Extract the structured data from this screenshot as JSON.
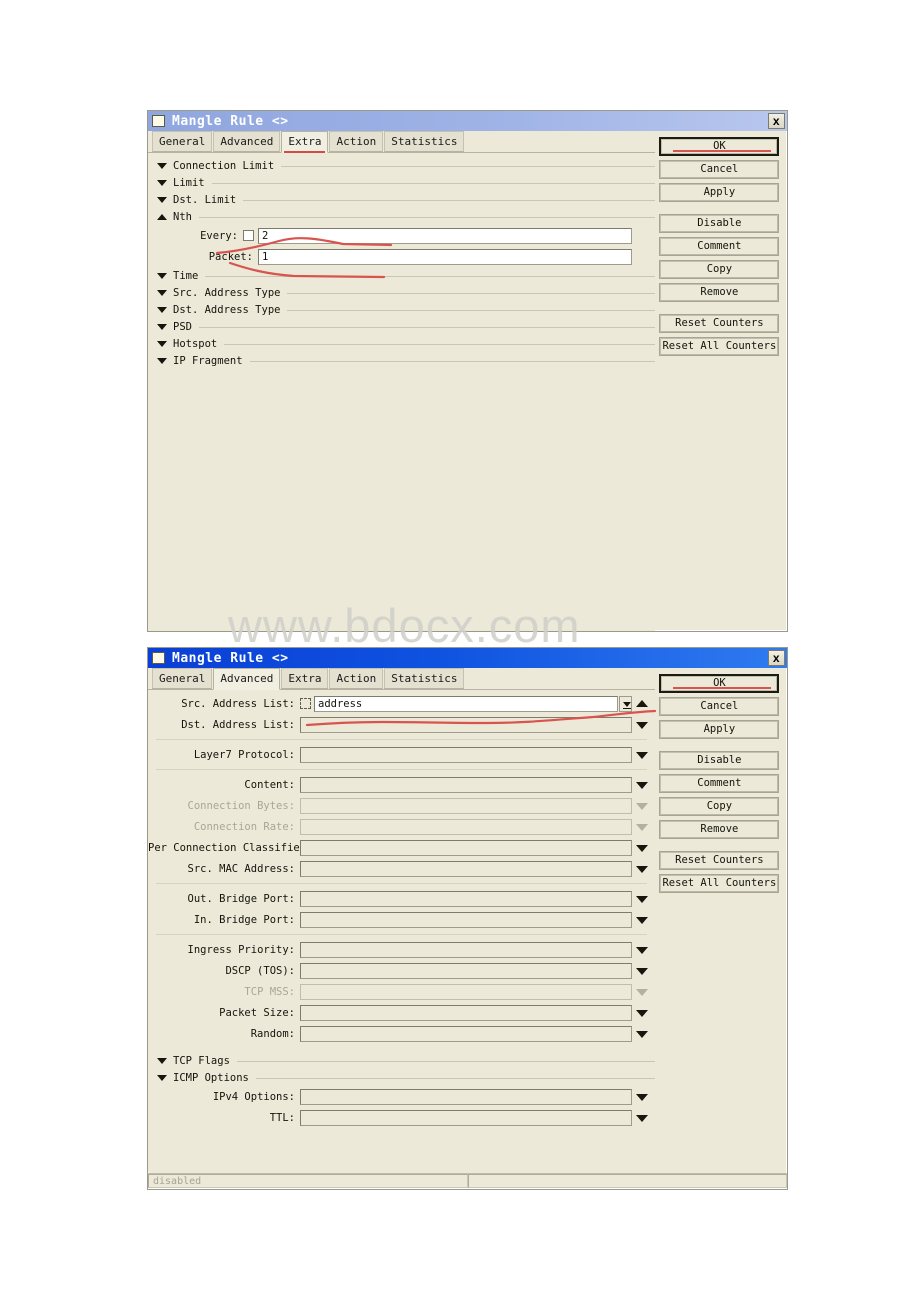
{
  "page": {
    "watermark": "www.bdocx.com",
    "background_color": "#ffffff"
  },
  "colors": {
    "dialog_face": "#ece9d8",
    "titlebar_active": "#0f52e0",
    "titlebar_inactive": "#9fb3e6",
    "annotation_red": "#d8544f",
    "field_white": "#ffffff",
    "disabled_text": "#a8a698"
  },
  "buttons_common": [
    {
      "label": "OK",
      "focused": true,
      "annotated": true
    },
    {
      "label": "Cancel",
      "focused": false,
      "annotated": false
    },
    {
      "label": "Apply",
      "focused": false,
      "annotated": false
    },
    {
      "label": "Disable",
      "focused": false,
      "annotated": false
    },
    {
      "label": "Comment",
      "focused": false,
      "annotated": false
    },
    {
      "label": "Copy",
      "focused": false,
      "annotated": false
    },
    {
      "label": "Remove",
      "focused": false,
      "annotated": false
    },
    {
      "label": "Reset Counters",
      "focused": false,
      "annotated": false
    },
    {
      "label": "Reset All Counters",
      "focused": false,
      "annotated": false
    }
  ],
  "dialog1": {
    "title": "Mangle Rule <>",
    "titlebar_state": "inactive",
    "close_icon": "close-icon",
    "close_label": "x",
    "tabs": [
      {
        "label": "General",
        "active": false
      },
      {
        "label": "Advanced",
        "active": false
      },
      {
        "label": "Extra",
        "active": true
      },
      {
        "label": "Action",
        "active": false
      },
      {
        "label": "Statistics",
        "active": false
      }
    ],
    "sections_before": [
      {
        "label": "Connection Limit",
        "expanded": false
      },
      {
        "label": "Limit",
        "expanded": false
      },
      {
        "label": "Dst. Limit",
        "expanded": false
      }
    ],
    "nth": {
      "label": "Nth",
      "expanded": true,
      "every_label": "Every:",
      "every_checked": false,
      "every_value": "2",
      "packet_label": "Packet:",
      "packet_value": "1"
    },
    "sections_after": [
      {
        "label": "Time",
        "expanded": false
      },
      {
        "label": "Src. Address Type",
        "expanded": false
      },
      {
        "label": "Dst. Address Type",
        "expanded": false
      },
      {
        "label": "PSD",
        "expanded": false
      },
      {
        "label": "Hotspot",
        "expanded": false
      },
      {
        "label": "IP Fragment",
        "expanded": false
      }
    ],
    "buttons": [
      {
        "label": "OK",
        "focused": true,
        "annotated": true
      },
      {
        "label": "Cancel",
        "focused": false,
        "annotated": false
      },
      {
        "label": "Apply",
        "focused": false,
        "annotated": false
      },
      {
        "label": "Disable",
        "focused": false,
        "annotated": false
      },
      {
        "label": "Comment",
        "focused": false,
        "annotated": false
      },
      {
        "label": "Copy",
        "focused": false,
        "annotated": false
      },
      {
        "label": "Remove",
        "focused": false,
        "annotated": false
      },
      {
        "label": "Reset Counters",
        "focused": false,
        "annotated": false
      },
      {
        "label": "Reset All Counters",
        "focused": false,
        "annotated": false
      }
    ]
  },
  "dialog2": {
    "title": "Mangle Rule <>",
    "titlebar_state": "active",
    "close_icon": "close-icon",
    "close_label": "x",
    "tabs": [
      {
        "label": "General",
        "active": false
      },
      {
        "label": "Advanced",
        "active": true
      },
      {
        "label": "Extra",
        "active": false
      },
      {
        "label": "Action",
        "active": false
      },
      {
        "label": "Statistics",
        "active": false
      }
    ],
    "fields": [
      {
        "label": "Src. Address List:",
        "value": "address",
        "disabled": false,
        "has_list_icon": true,
        "has_drop_button": true,
        "arrow": "up"
      },
      {
        "label": "Dst. Address List:",
        "value": "",
        "disabled": false,
        "has_list_icon": false,
        "has_drop_button": false,
        "arrow": "down"
      },
      {
        "sep": true
      },
      {
        "label": "Layer7 Protocol:",
        "value": "",
        "disabled": false,
        "has_list_icon": false,
        "has_drop_button": false,
        "arrow": "down"
      },
      {
        "sep": true
      },
      {
        "label": "Content:",
        "value": "",
        "disabled": false,
        "has_list_icon": false,
        "has_drop_button": false,
        "arrow": "down"
      },
      {
        "label": "Connection Bytes:",
        "value": "",
        "disabled": true,
        "has_list_icon": false,
        "has_drop_button": false,
        "arrow": "down-dim"
      },
      {
        "label": "Connection Rate:",
        "value": "",
        "disabled": true,
        "has_list_icon": false,
        "has_drop_button": false,
        "arrow": "down-dim"
      },
      {
        "label": "Per Connection Classifier:",
        "value": "",
        "disabled": false,
        "has_list_icon": false,
        "has_drop_button": false,
        "arrow": "down"
      },
      {
        "label": "Src. MAC Address:",
        "value": "",
        "disabled": false,
        "has_list_icon": false,
        "has_drop_button": false,
        "arrow": "down"
      },
      {
        "sep": true
      },
      {
        "label": "Out. Bridge Port:",
        "value": "",
        "disabled": false,
        "has_list_icon": false,
        "has_drop_button": false,
        "arrow": "down"
      },
      {
        "label": "In. Bridge Port:",
        "value": "",
        "disabled": false,
        "has_list_icon": false,
        "has_drop_button": false,
        "arrow": "down"
      },
      {
        "sep": true
      },
      {
        "label": "Ingress Priority:",
        "value": "",
        "disabled": false,
        "has_list_icon": false,
        "has_drop_button": false,
        "arrow": "down"
      },
      {
        "label": "DSCP (TOS):",
        "value": "",
        "disabled": false,
        "has_list_icon": false,
        "has_drop_button": false,
        "arrow": "down"
      },
      {
        "label": "TCP MSS:",
        "value": "",
        "disabled": true,
        "has_list_icon": false,
        "has_drop_button": false,
        "arrow": "down-dim"
      },
      {
        "label": "Packet Size:",
        "value": "",
        "disabled": false,
        "has_list_icon": false,
        "has_drop_button": false,
        "arrow": "down"
      },
      {
        "label": "Random:",
        "value": "",
        "disabled": false,
        "has_list_icon": false,
        "has_drop_button": false,
        "arrow": "down"
      }
    ],
    "sections": [
      {
        "label": "TCP Flags",
        "expanded": false
      },
      {
        "label": "ICMP Options",
        "expanded": false
      }
    ],
    "icmp_fields": [
      {
        "label": "IPv4 Options:",
        "value": "",
        "disabled": false,
        "arrow": "down"
      },
      {
        "label": "TTL:",
        "value": "",
        "disabled": false,
        "arrow": "down"
      }
    ],
    "statusbar": {
      "left_text": "disabled",
      "right_text": ""
    },
    "buttons": [
      {
        "label": "OK",
        "focused": true,
        "annotated": true
      },
      {
        "label": "Cancel",
        "focused": false,
        "annotated": false
      },
      {
        "label": "Apply",
        "focused": false,
        "annotated": false
      },
      {
        "label": "Disable",
        "focused": false,
        "annotated": false
      },
      {
        "label": "Comment",
        "focused": false,
        "annotated": false
      },
      {
        "label": "Copy",
        "focused": false,
        "annotated": false
      },
      {
        "label": "Remove",
        "focused": false,
        "annotated": false
      },
      {
        "label": "Reset Counters",
        "focused": false,
        "annotated": false
      },
      {
        "label": "Reset All Counters",
        "focused": false,
        "annotated": false
      }
    ]
  }
}
